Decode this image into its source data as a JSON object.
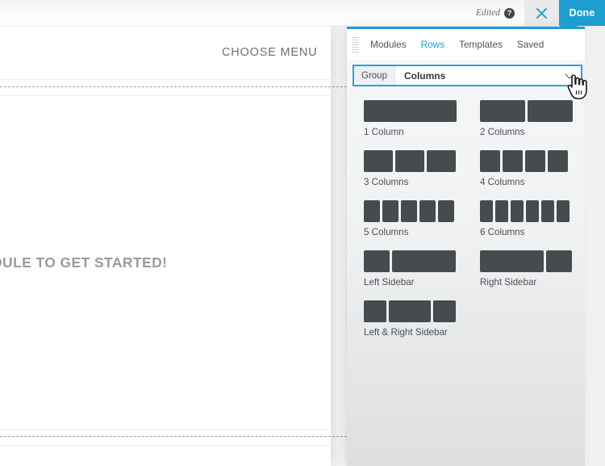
{
  "admin_bar": {
    "edited_label": "Edited",
    "help_icon": "help-question-icon",
    "close_icon": "close-x-icon",
    "done_label": "Done"
  },
  "page": {
    "choose_menu": "CHOOSE MENU",
    "get_started": "DULE TO GET STARTED!"
  },
  "panel": {
    "accent_color": "#1e9dd0",
    "tabs": [
      {
        "label": "Modules",
        "active": false
      },
      {
        "label": "Rows",
        "active": true
      },
      {
        "label": "Templates",
        "active": false
      },
      {
        "label": "Saved",
        "active": false
      }
    ],
    "group_select": {
      "label": "Group",
      "value": "Columns",
      "chevron_icon": "chevron-down-icon"
    },
    "rows": [
      {
        "label": "1 Column",
        "widths": [
          115
        ]
      },
      {
        "label": "2 Columns",
        "widths": [
          56,
          56
        ]
      },
      {
        "label": "3 Columns",
        "widths": [
          36,
          36,
          36
        ]
      },
      {
        "label": "4 Columns",
        "widths": [
          25,
          25,
          25,
          25
        ]
      },
      {
        "label": "5 Columns",
        "widths": [
          20,
          20,
          20,
          20,
          20
        ]
      },
      {
        "label": "6 Columns",
        "widths": [
          16,
          16,
          16,
          16,
          16,
          16
        ]
      },
      {
        "label": "Left Sidebar",
        "widths": [
          32,
          79
        ]
      },
      {
        "label": "Right Sidebar",
        "widths": [
          79,
          32
        ]
      },
      {
        "label": "Left & Right Sidebar",
        "widths": [
          28,
          52,
          28
        ]
      }
    ]
  },
  "cursor": {
    "icon": "hand-pointer-cursor"
  }
}
